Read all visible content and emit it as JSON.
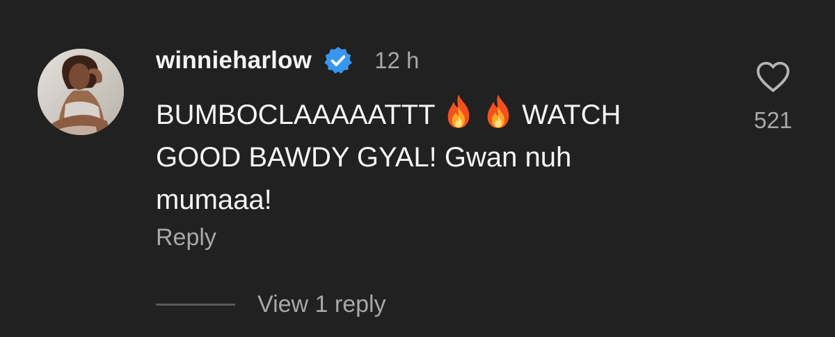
{
  "comment": {
    "username": "winnieharlow",
    "verified_icon": "verified-badge-icon",
    "timestamp": "12 h",
    "text_part1": "BUMBOCLAAAAATTT ",
    "text_part2": " WATCH\nGOOD BAWDY GYAL! Gwan nuh\nmumaaa!",
    "emoji_icon": "fire-emoji-icon",
    "reply_label": "Reply",
    "view_replies_label": "View 1 reply",
    "like_count": "521",
    "like_icon": "heart-outline-icon"
  },
  "colors": {
    "background": "#212121",
    "text_primary": "#f5f5f5",
    "text_secondary": "#a8a8a8",
    "verified_blue": "#3797f0"
  }
}
